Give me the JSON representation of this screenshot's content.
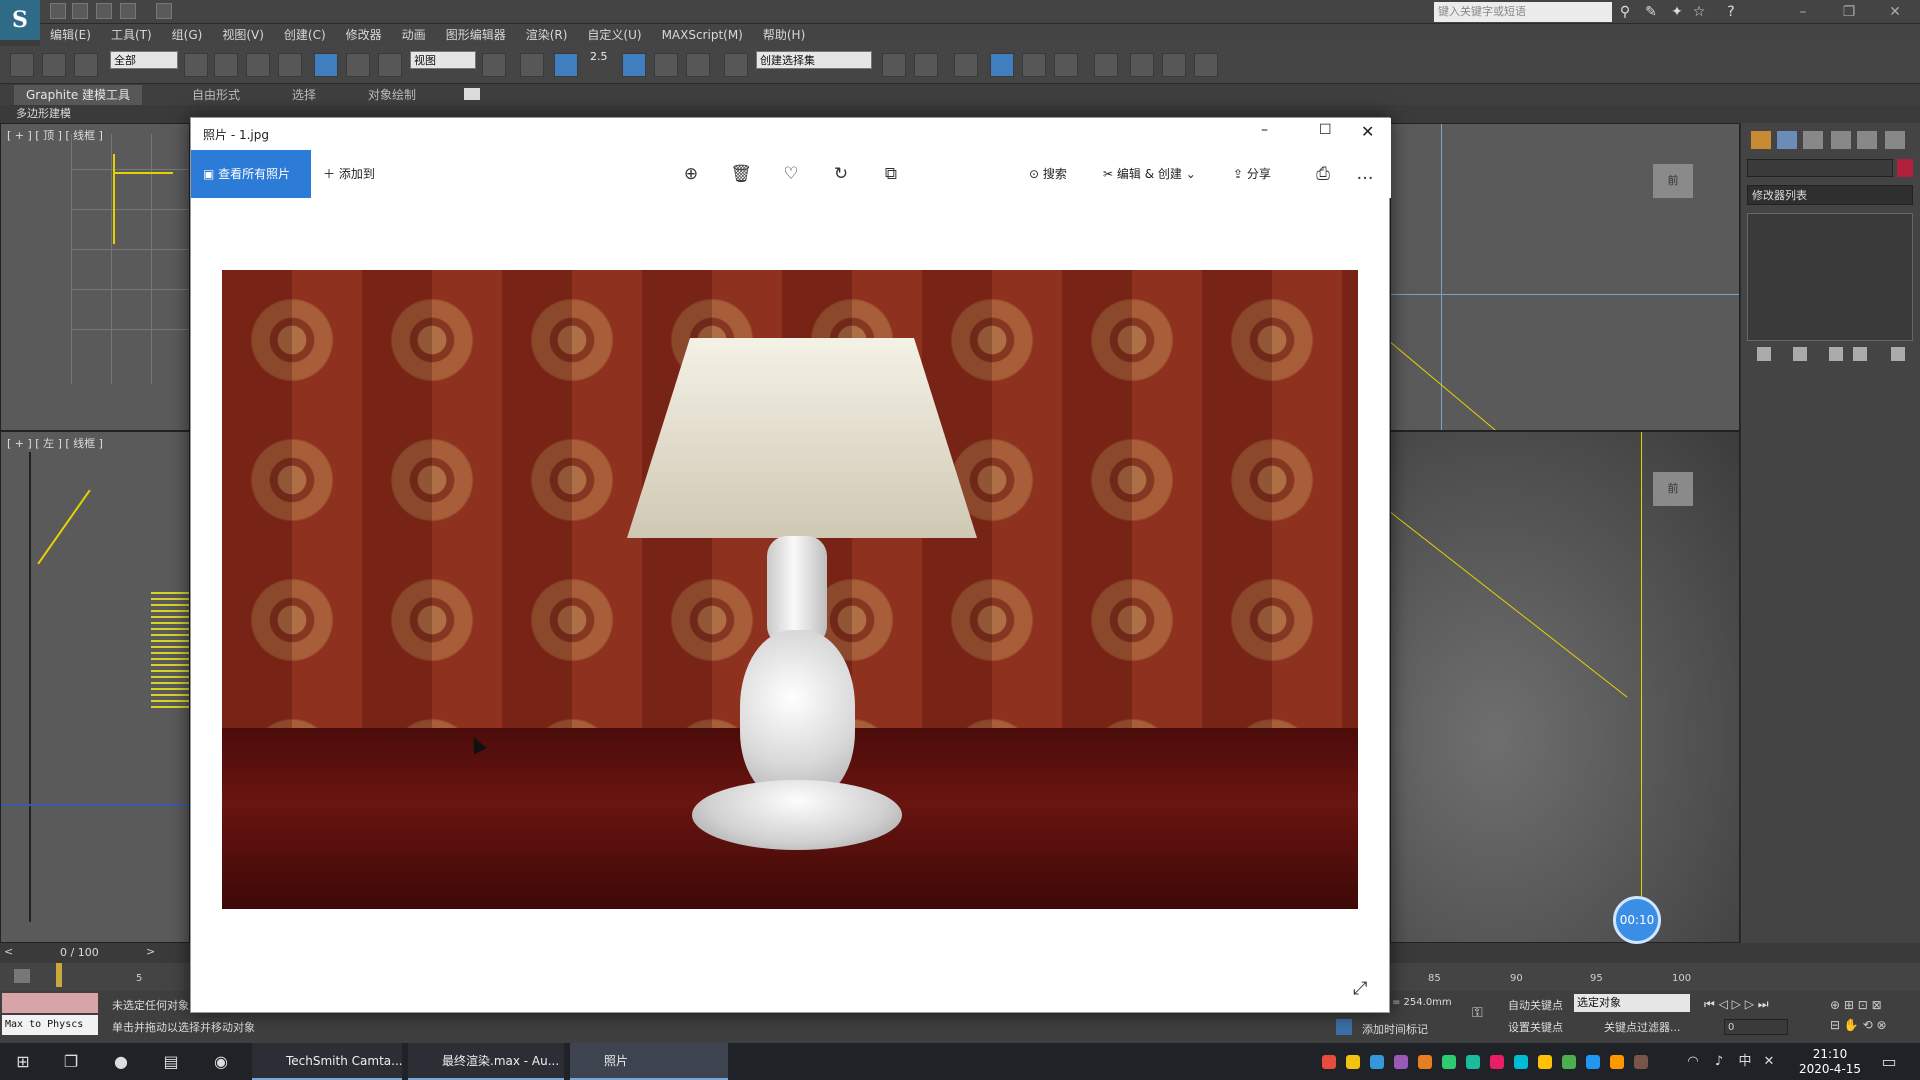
{
  "max": {
    "search_placeholder": "键入关键字或短语",
    "menus": [
      "编辑(E)",
      "工具(T)",
      "组(G)",
      "视图(V)",
      "创建(C)",
      "修改器",
      "动画",
      "图形编辑器",
      "渲染(R)",
      "自定义(U)",
      "MAXScript(M)",
      "帮助(H)"
    ],
    "toolbar": {
      "filter_value": "全部",
      "refcoord_value": "视图",
      "snap_label": "2.5",
      "selset_value": "创建选择集"
    },
    "ribbon_tabs": [
      "Graphite 建模工具",
      "自由形式",
      "选择",
      "对象绘制"
    ],
    "ribbon_sub": "多边形建模",
    "viewport_top_label": "[ + ] [ 顶 ] [ 线框 ]",
    "viewport_left_label": "[ + ] [ 左 ] [ 线框 ]",
    "nav_cube_label": "前",
    "modifier_list": "修改器列表",
    "frame_counter": "0 / 100",
    "ticks": [
      "5",
      "85",
      "90",
      "95",
      "100"
    ],
    "status_msg1": "未选定任何对象",
    "status_msg2": "单击并拖动以选择并移动对象",
    "maxscript_label": "Max to Physcs",
    "add_time_tag": "添加时间标记",
    "auto_key": "自动关键点",
    "set_key": "设置关键点",
    "key_mode_value": "选定对象",
    "key_filters": "关键点过滤器...",
    "grid_value": "= 254.0mm",
    "frame_field": "0"
  },
  "photos": {
    "title": "照片 - 1.jpg",
    "view_all": "查看所有照片",
    "add_to": "添加到",
    "search": "搜索",
    "edit_create": "编辑 & 创建",
    "share": "分享",
    "more": "…"
  },
  "recording_time": "00:10",
  "taskbar": {
    "tasks": [
      "TechSmith Camta...",
      "最终渲染.max - Au...",
      "照片"
    ],
    "time": "21:10",
    "date": "2020-4-15"
  }
}
